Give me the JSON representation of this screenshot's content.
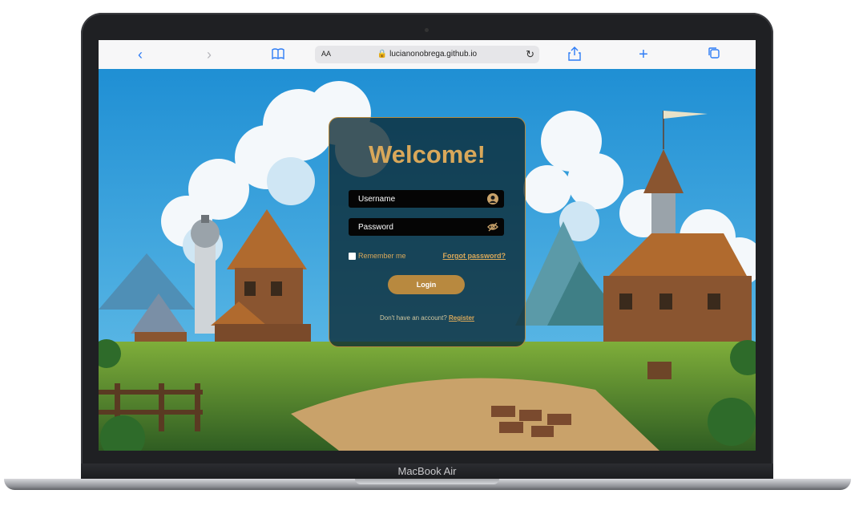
{
  "browser": {
    "text_size_label": "AA",
    "url": "lucianonobrega.github.io"
  },
  "laptop": {
    "model_label": "MacBook Air"
  },
  "login": {
    "title": "Welcome!",
    "username_placeholder": "Username",
    "password_placeholder": "Password",
    "remember_label": "Remember me",
    "forgot_label": "Forgot password?",
    "login_button": "Login",
    "no_account_text": "Don't have an account?",
    "register_link": "Register"
  },
  "colors": {
    "accent_gold": "#d9a85a",
    "button_gold": "#b8893f",
    "card_bg": "rgba(10,40,50,0.78)",
    "safari_blue": "#2f7df6"
  },
  "icons": {
    "back": "chevron-left-icon",
    "forward": "chevron-right-icon",
    "bookmarks": "book-icon",
    "lock": "lock-icon",
    "reload": "reload-icon",
    "share": "share-icon",
    "new_tab": "plus-icon",
    "tabs": "tabs-icon",
    "user": "user-icon",
    "eye_off": "eye-off-icon"
  }
}
